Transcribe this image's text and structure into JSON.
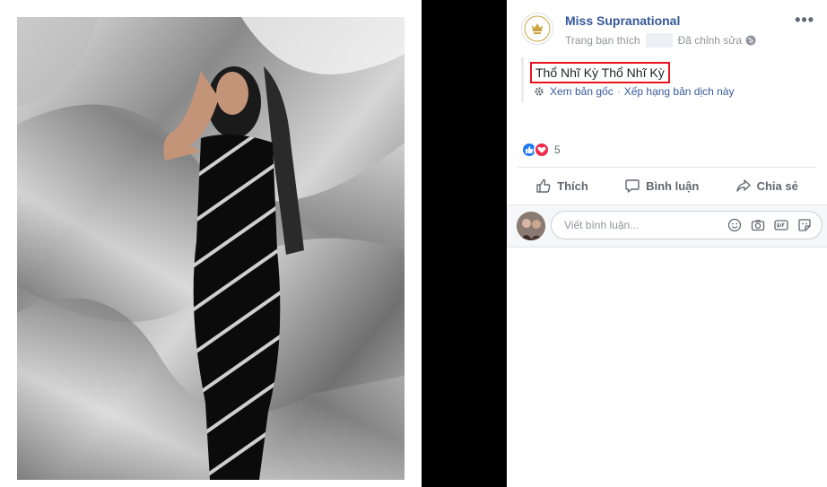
{
  "post": {
    "page_name": "Miss Supranational",
    "meta_liked": "Trang bạn thích",
    "meta_edited": "Đã chỉnh sửa",
    "translated_text": "Thổ Nhĩ Kỳ Thổ Nhĩ Kỳ",
    "see_original": "Xem bản gốc",
    "rate_translation": "Xếp hạng bản dịch này",
    "reaction_count": "5"
  },
  "actions": {
    "like": "Thích",
    "comment": "Bình luận",
    "share": "Chia sẻ"
  },
  "comment_box": {
    "placeholder": "Viết bình luận..."
  },
  "colors": {
    "link": "#365899",
    "highlight_border": "#e8141b",
    "like_blue": "#2078f4",
    "love_red": "#f0284a"
  }
}
